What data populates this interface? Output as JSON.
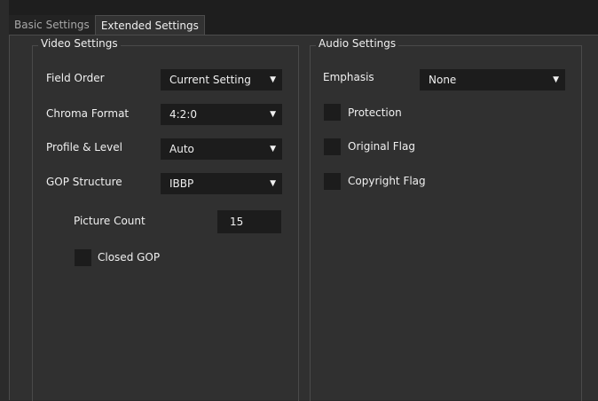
{
  "tabs": [
    "Basic Settings",
    "Extended Settings"
  ],
  "video": {
    "title": "Video Settings",
    "field_order": {
      "label": "Field Order",
      "value": "Current Setting"
    },
    "chroma_format": {
      "label": "Chroma Format",
      "value": "4:2:0"
    },
    "profile_level": {
      "label": "Profile & Level",
      "value": "Auto"
    },
    "gop_structure": {
      "label": "GOP Structure",
      "value": "IBBP"
    },
    "picture_count": {
      "label": "Picture Count",
      "value": "15"
    },
    "closed_gop": {
      "label": "Closed GOP",
      "checked": false
    }
  },
  "audio": {
    "title": "Audio Settings",
    "emphasis": {
      "label": "Emphasis",
      "value": "None"
    },
    "protection": {
      "label": "Protection",
      "checked": false
    },
    "original_flag": {
      "label": "Original Flag",
      "checked": false
    },
    "copyright_flag": {
      "label": "Copyright Flag",
      "checked": false
    }
  },
  "icons": {
    "dropdown": "▼"
  }
}
